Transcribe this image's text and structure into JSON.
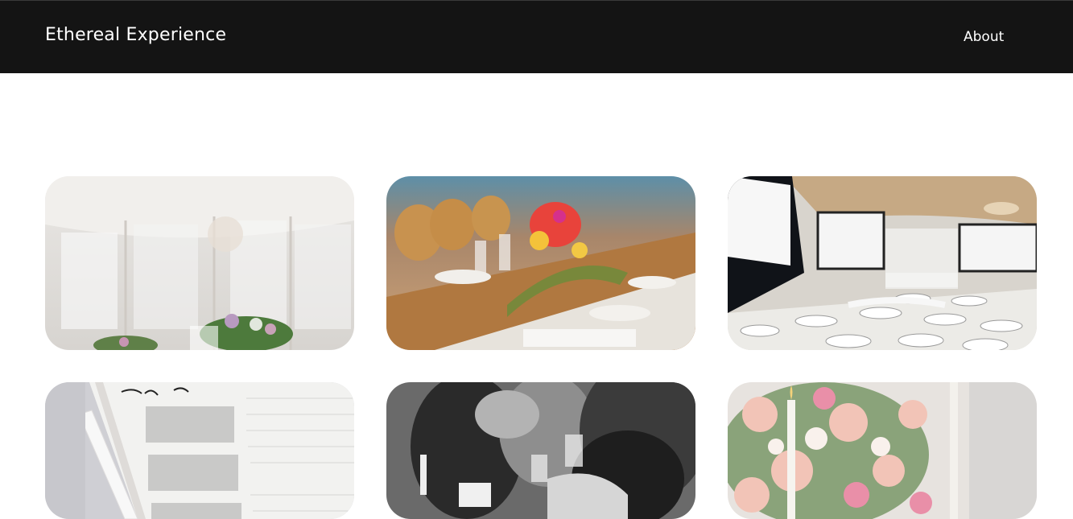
{
  "header": {
    "brand": "Ethereal Experience",
    "nav": [
      {
        "label": "About"
      }
    ],
    "background": "#141414",
    "text_color": "#ffffff"
  },
  "gallery": {
    "items": [
      {
        "name": "white-tent-venue-image"
      },
      {
        "name": "floral-banquet-table-image"
      },
      {
        "name": "conference-hall-image"
      },
      {
        "name": "weekly-planner-image"
      },
      {
        "name": "bw-toast-celebration-image"
      },
      {
        "name": "pink-roses-centerpiece-image"
      }
    ]
  }
}
